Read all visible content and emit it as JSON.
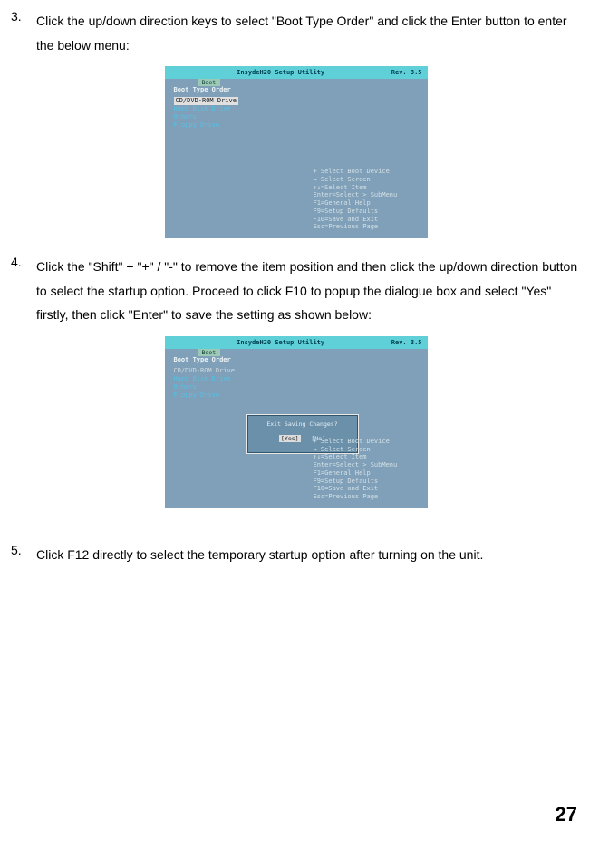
{
  "item3": {
    "num": "3.",
    "text": "Click the up/down direction keys to select \"Boot Type Order\" and click the Enter button to enter the below menu:"
  },
  "item4": {
    "num": "4.",
    "text": "Click the \"Shift\" + \"+\" / \"-\" to remove the item position and then click the up/down direction button to select the startup option. Proceed to click F10 to popup the dialogue box and select \"Yes\" firstly, then click \"Enter\" to save the setting as shown below:"
  },
  "item5": {
    "num": "5.",
    "text": "Click F12 directly to select the temporary startup option after turning on the unit."
  },
  "bios": {
    "utility_title": "InsydeH20 Setup Utility",
    "rev": "Rev. 3.5",
    "tab": "Boot",
    "header": "Boot Type Order",
    "selected": "CD/DVD-ROM Drive",
    "line2": "Hard Disk Drive",
    "line3": "Others",
    "line4": "Floppy Drive",
    "help": {
      "l1": "+    Select Boot Device",
      "l2": "↔    Select Screen",
      "l3": "↑↓=Select Item",
      "l4": "Enter=Select > SubMenu",
      "l5": "F1=General Help",
      "l6": "F9=Setup Defaults",
      "l7": "F10=Save and Exit",
      "l8": "Esc=Previous Page"
    }
  },
  "dialog": {
    "title": "Exit Saving Changes?",
    "yes": "[Yes]",
    "no": "[No]"
  },
  "page_number": "27"
}
